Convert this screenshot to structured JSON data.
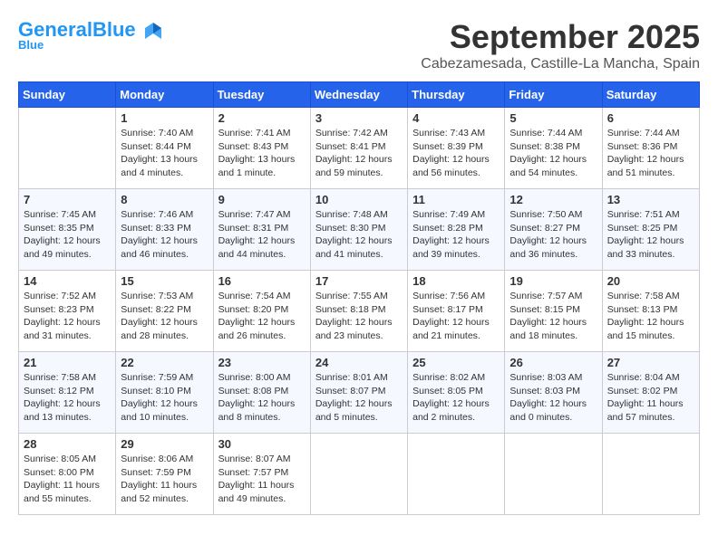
{
  "header": {
    "logo_general": "General",
    "logo_blue": "Blue",
    "title": "September 2025",
    "location": "Cabezamesada, Castille-La Mancha, Spain"
  },
  "weekdays": [
    "Sunday",
    "Monday",
    "Tuesday",
    "Wednesday",
    "Thursday",
    "Friday",
    "Saturday"
  ],
  "weeks": [
    [
      {
        "day": "",
        "info": ""
      },
      {
        "day": "1",
        "info": "Sunrise: 7:40 AM\nSunset: 8:44 PM\nDaylight: 13 hours\nand 4 minutes."
      },
      {
        "day": "2",
        "info": "Sunrise: 7:41 AM\nSunset: 8:43 PM\nDaylight: 13 hours\nand 1 minute."
      },
      {
        "day": "3",
        "info": "Sunrise: 7:42 AM\nSunset: 8:41 PM\nDaylight: 12 hours\nand 59 minutes."
      },
      {
        "day": "4",
        "info": "Sunrise: 7:43 AM\nSunset: 8:39 PM\nDaylight: 12 hours\nand 56 minutes."
      },
      {
        "day": "5",
        "info": "Sunrise: 7:44 AM\nSunset: 8:38 PM\nDaylight: 12 hours\nand 54 minutes."
      },
      {
        "day": "6",
        "info": "Sunrise: 7:44 AM\nSunset: 8:36 PM\nDaylight: 12 hours\nand 51 minutes."
      }
    ],
    [
      {
        "day": "7",
        "info": "Sunrise: 7:45 AM\nSunset: 8:35 PM\nDaylight: 12 hours\nand 49 minutes."
      },
      {
        "day": "8",
        "info": "Sunrise: 7:46 AM\nSunset: 8:33 PM\nDaylight: 12 hours\nand 46 minutes."
      },
      {
        "day": "9",
        "info": "Sunrise: 7:47 AM\nSunset: 8:31 PM\nDaylight: 12 hours\nand 44 minutes."
      },
      {
        "day": "10",
        "info": "Sunrise: 7:48 AM\nSunset: 8:30 PM\nDaylight: 12 hours\nand 41 minutes."
      },
      {
        "day": "11",
        "info": "Sunrise: 7:49 AM\nSunset: 8:28 PM\nDaylight: 12 hours\nand 39 minutes."
      },
      {
        "day": "12",
        "info": "Sunrise: 7:50 AM\nSunset: 8:27 PM\nDaylight: 12 hours\nand 36 minutes."
      },
      {
        "day": "13",
        "info": "Sunrise: 7:51 AM\nSunset: 8:25 PM\nDaylight: 12 hours\nand 33 minutes."
      }
    ],
    [
      {
        "day": "14",
        "info": "Sunrise: 7:52 AM\nSunset: 8:23 PM\nDaylight: 12 hours\nand 31 minutes."
      },
      {
        "day": "15",
        "info": "Sunrise: 7:53 AM\nSunset: 8:22 PM\nDaylight: 12 hours\nand 28 minutes."
      },
      {
        "day": "16",
        "info": "Sunrise: 7:54 AM\nSunset: 8:20 PM\nDaylight: 12 hours\nand 26 minutes."
      },
      {
        "day": "17",
        "info": "Sunrise: 7:55 AM\nSunset: 8:18 PM\nDaylight: 12 hours\nand 23 minutes."
      },
      {
        "day": "18",
        "info": "Sunrise: 7:56 AM\nSunset: 8:17 PM\nDaylight: 12 hours\nand 21 minutes."
      },
      {
        "day": "19",
        "info": "Sunrise: 7:57 AM\nSunset: 8:15 PM\nDaylight: 12 hours\nand 18 minutes."
      },
      {
        "day": "20",
        "info": "Sunrise: 7:58 AM\nSunset: 8:13 PM\nDaylight: 12 hours\nand 15 minutes."
      }
    ],
    [
      {
        "day": "21",
        "info": "Sunrise: 7:58 AM\nSunset: 8:12 PM\nDaylight: 12 hours\nand 13 minutes."
      },
      {
        "day": "22",
        "info": "Sunrise: 7:59 AM\nSunset: 8:10 PM\nDaylight: 12 hours\nand 10 minutes."
      },
      {
        "day": "23",
        "info": "Sunrise: 8:00 AM\nSunset: 8:08 PM\nDaylight: 12 hours\nand 8 minutes."
      },
      {
        "day": "24",
        "info": "Sunrise: 8:01 AM\nSunset: 8:07 PM\nDaylight: 12 hours\nand 5 minutes."
      },
      {
        "day": "25",
        "info": "Sunrise: 8:02 AM\nSunset: 8:05 PM\nDaylight: 12 hours\nand 2 minutes."
      },
      {
        "day": "26",
        "info": "Sunrise: 8:03 AM\nSunset: 8:03 PM\nDaylight: 12 hours\nand 0 minutes."
      },
      {
        "day": "27",
        "info": "Sunrise: 8:04 AM\nSunset: 8:02 PM\nDaylight: 11 hours\nand 57 minutes."
      }
    ],
    [
      {
        "day": "28",
        "info": "Sunrise: 8:05 AM\nSunset: 8:00 PM\nDaylight: 11 hours\nand 55 minutes."
      },
      {
        "day": "29",
        "info": "Sunrise: 8:06 AM\nSunset: 7:59 PM\nDaylight: 11 hours\nand 52 minutes."
      },
      {
        "day": "30",
        "info": "Sunrise: 8:07 AM\nSunset: 7:57 PM\nDaylight: 11 hours\nand 49 minutes."
      },
      {
        "day": "",
        "info": ""
      },
      {
        "day": "",
        "info": ""
      },
      {
        "day": "",
        "info": ""
      },
      {
        "day": "",
        "info": ""
      }
    ]
  ]
}
